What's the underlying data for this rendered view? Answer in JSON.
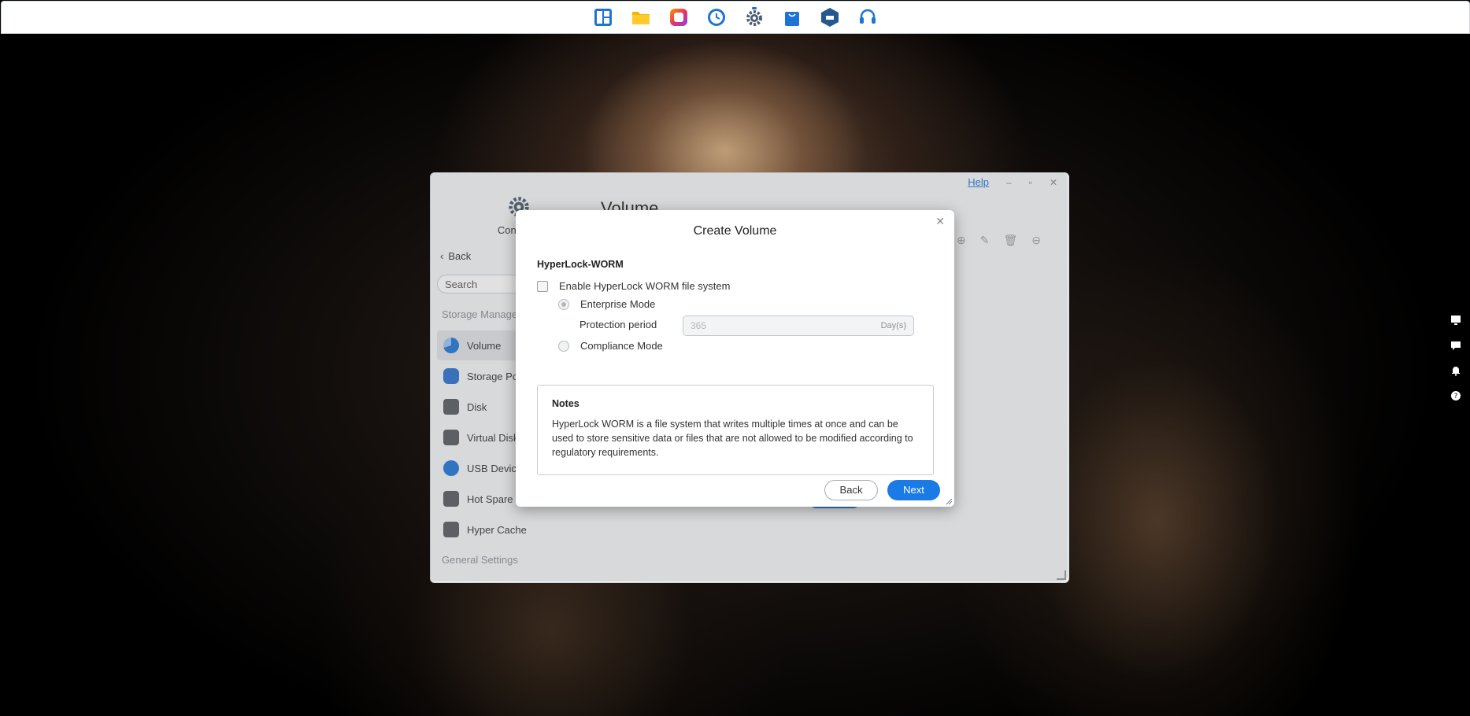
{
  "taskbar": {
    "icons": [
      "dashboard-icon",
      "file-manager-icon",
      "photo-app-icon",
      "backup-clock-icon",
      "control-panel-gear-icon",
      "app-center-bag-icon",
      "container-icon",
      "support-headset-icon"
    ]
  },
  "side_widgets": [
    "monitor-icon",
    "chat-icon",
    "notification-bell-icon",
    "help-circle-icon"
  ],
  "control_panel": {
    "help_label": "Help",
    "app_label": "Control P",
    "back_label": "Back",
    "search_placeholder": "Search",
    "section_storage": "Storage Manage",
    "section_general": "General Settings",
    "main_title": "Volume",
    "nav": [
      {
        "label": "Volume",
        "color": "#1e74d6"
      },
      {
        "label": "Storage Po",
        "color": "#2b6fcf"
      },
      {
        "label": "Disk",
        "color": "#555a60"
      },
      {
        "label": "Virtual Disk",
        "color": "#555a60"
      },
      {
        "label": "USB Device",
        "color": "#1e74d6"
      },
      {
        "label": "Hot Spare",
        "color": "#555a60"
      },
      {
        "label": "Hyper Cache",
        "color": "#555a60"
      }
    ]
  },
  "modal": {
    "title": "Create Volume",
    "section_title": "HyperLock-WORM",
    "enable_label": "Enable HyperLock WORM file system",
    "enterprise_label": "Enterprise Mode",
    "protection_label": "Protection period",
    "protection_value": "365",
    "protection_unit": "Day(s)",
    "compliance_label": "Compliance Mode",
    "notes_title": "Notes",
    "notes_text": "HyperLock WORM is a file system that writes multiple times at once and can be used to store sensitive data or files that are not allowed to be modified according to regulatory requirements.",
    "back_label": "Back",
    "next_label": "Next"
  },
  "colors": {
    "accent": "#1a7ae6",
    "link": "#1e74d6"
  }
}
